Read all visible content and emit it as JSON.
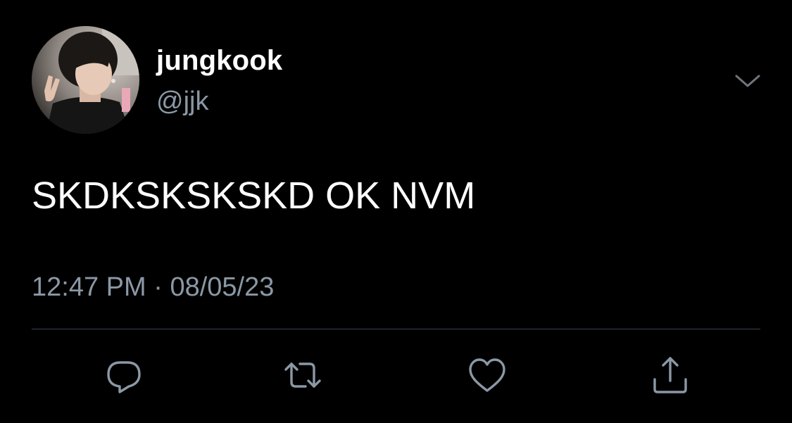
{
  "author": {
    "display_name": "jungkook",
    "handle": "@jjk"
  },
  "tweet": {
    "text": "SKDKSKSKSKD OK NVM",
    "time": "12:47 PM",
    "separator": "·",
    "date": "08/05/23"
  },
  "icons": {
    "more": "chevron-down-icon",
    "reply": "reply-icon",
    "retweet": "retweet-icon",
    "like": "heart-icon",
    "share": "share-icon"
  },
  "colors": {
    "background": "#000000",
    "primary_text": "#ffffff",
    "secondary_text": "#8b98a5",
    "divider": "#38444d"
  }
}
